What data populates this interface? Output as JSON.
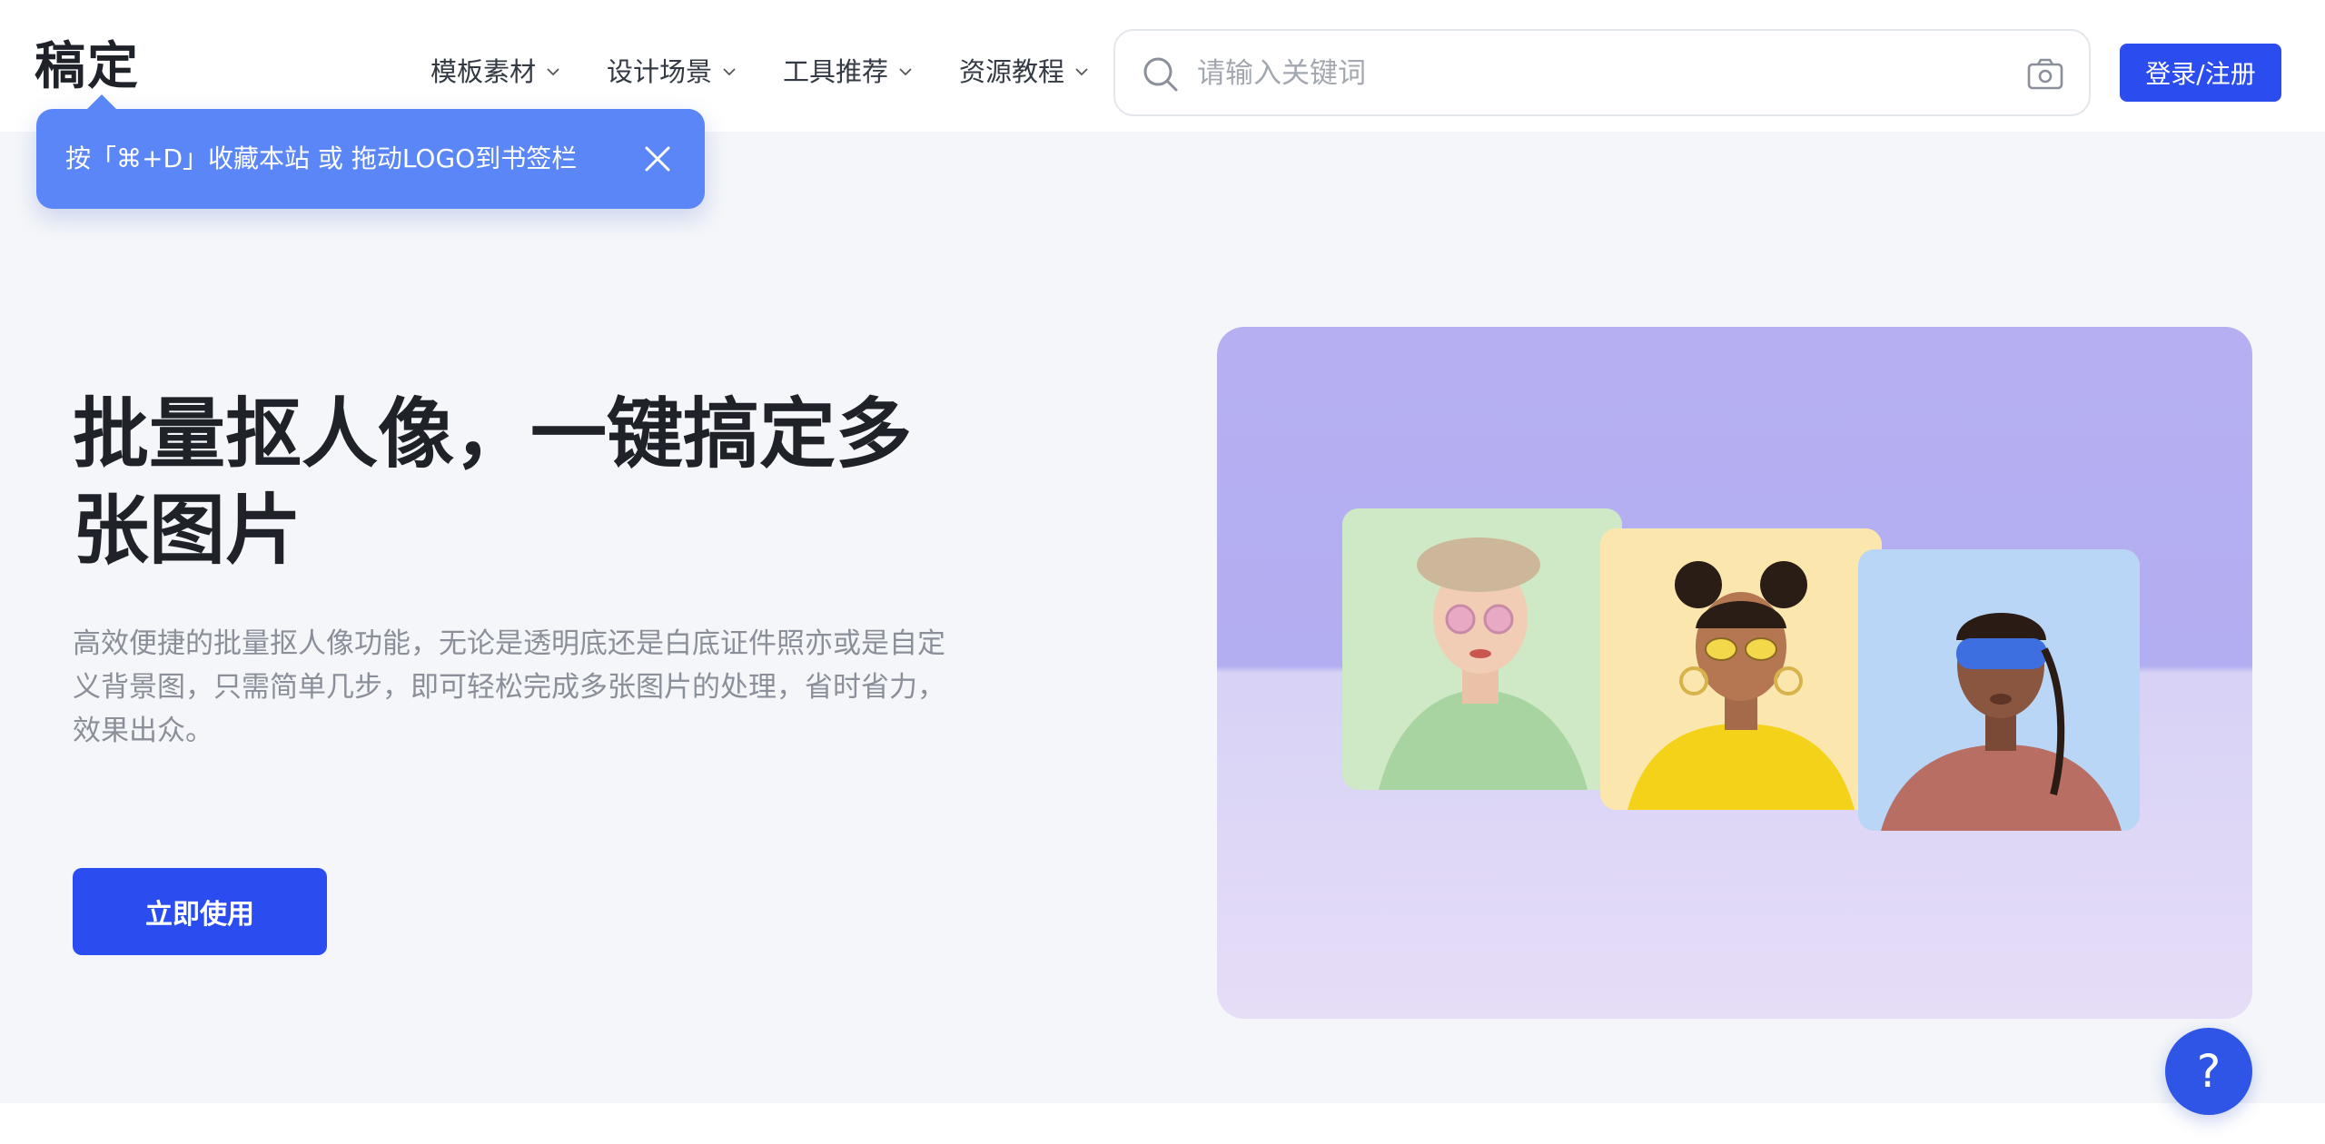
{
  "brand": {
    "logo": "稿定"
  },
  "nav": {
    "items": [
      {
        "label": "模板素材"
      },
      {
        "label": "设计场景"
      },
      {
        "label": "工具推荐"
      },
      {
        "label": "资源教程"
      }
    ]
  },
  "search": {
    "placeholder": "请输入关键词"
  },
  "auth": {
    "login_label": "登录/注册"
  },
  "toast": {
    "text": "按「⌘+D」收藏本站 或 拖动LOGO到书签栏"
  },
  "hero": {
    "title": "批量抠人像，一键搞定多张图片",
    "description": "高效便捷的批量抠人像功能，无论是透明底还是白底证件照亦或是自定义背景图，只需简单几步，即可轻松完成多张图片的处理，省时省力，效果出众。",
    "cta_label": "立即使用"
  },
  "help": {
    "label": "?"
  },
  "colors": {
    "accent": "#2b4df0",
    "toast_bg": "#5b86f7",
    "hero_bg": "#f4f6f9"
  },
  "icons": {
    "search": "search-icon",
    "camera": "camera-icon",
    "close": "close-icon",
    "chevron": "chevron-down-icon"
  }
}
